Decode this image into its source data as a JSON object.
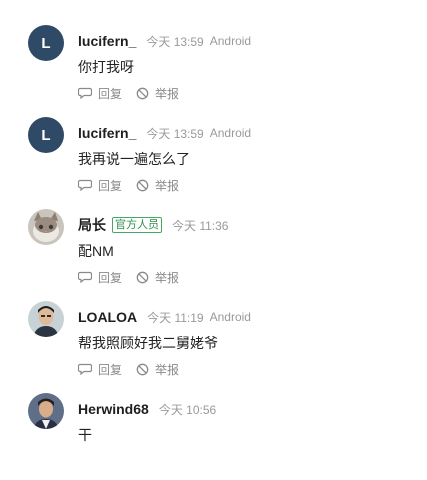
{
  "comments": [
    {
      "avatar_letter": "L",
      "username": "lucifern_",
      "badge": "",
      "time": "今天 13:59",
      "platform": "Android",
      "content": "你打我呀",
      "actions": [
        "回复",
        "举报"
      ]
    },
    {
      "avatar_letter": "L",
      "username": "lucifern_",
      "badge": "",
      "time": "今天 13:59",
      "platform": "Android",
      "content": "我再说一遍怎么了",
      "actions": [
        "回复",
        "举报"
      ]
    },
    {
      "avatar_letter": "",
      "username": "局长",
      "badge": "官方人员",
      "time": "今天 11:36",
      "platform": "",
      "content": "配NM",
      "actions": [
        "回复",
        "举报"
      ]
    },
    {
      "avatar_letter": "",
      "username": "LOALOA",
      "badge": "",
      "time": "今天 11:19",
      "platform": "Android",
      "content": "帮我照顾好我二舅姥爷",
      "actions": [
        "回复",
        "举报"
      ]
    },
    {
      "avatar_letter": "",
      "username": "Herwind68",
      "badge": "",
      "time": "今天 10:56",
      "platform": "",
      "content": "干",
      "actions": []
    }
  ],
  "colors": {
    "letter_avatar_bg": "#2f4a66",
    "badge_green": "#2f8f4e",
    "meta_gray": "#9a9a9a"
  },
  "icons": {
    "reply": "comment-bubble-icon",
    "report": "prohibited-icon"
  }
}
